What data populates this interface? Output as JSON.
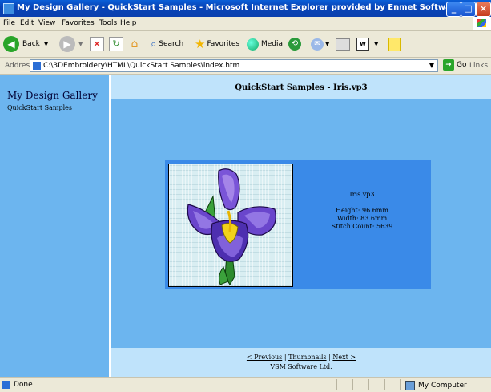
{
  "window": {
    "title": "My Design Gallery - QuickStart Samples - Microsoft Internet Explorer provided by Enmet Software"
  },
  "menu": [
    "File",
    "Edit",
    "View",
    "Favorites",
    "Tools",
    "Help"
  ],
  "toolbar": {
    "back_label": "Back",
    "search_label": "Search",
    "favorites_label": "Favorites",
    "media_label": "Media"
  },
  "addressbar": {
    "label": "Address",
    "url": "C:\\3DEmbroidery\\HTML\\QuickStart Samples\\index.htm",
    "go_label": "Go",
    "links_label": "Links"
  },
  "sidebar": {
    "title": "My Design Gallery",
    "link": "QuickStart Samples"
  },
  "page": {
    "title": "QuickStart Samples - Iris.vp3"
  },
  "design": {
    "name": "Iris.vp3",
    "height": "Height: 96.6mm",
    "width": "Width: 83.6mm",
    "stitches": "Stitch Count: 5639"
  },
  "footer": {
    "prev": "< Previous",
    "thumbs": "Thumbnails",
    "next": "Next >",
    "sep": "|",
    "copyright": "VSM Software Ltd."
  },
  "status": {
    "left": "Done",
    "right": "My Computer"
  },
  "colors": {
    "panel": "#6cb5ef",
    "band": "#bfe3fb",
    "card": "#3a8ae8"
  }
}
